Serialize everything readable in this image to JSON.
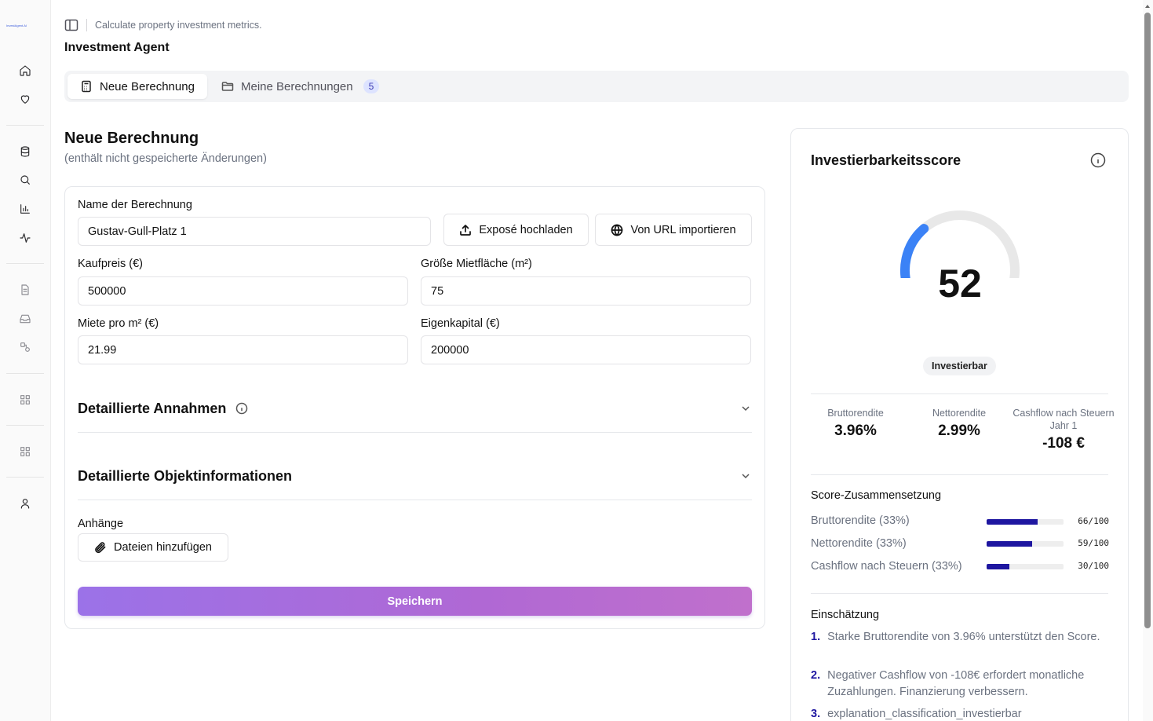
{
  "app": {
    "logo_text": "InvestAgent.AI"
  },
  "header": {
    "subtitle": "Calculate property investment metrics.",
    "title": "Investment Agent"
  },
  "tabs": [
    {
      "label": "Neue Berechnung",
      "icon": "calculator-icon",
      "active": true
    },
    {
      "label": "Meine Berechnungen",
      "icon": "folder-icon",
      "active": false,
      "badge": "5"
    }
  ],
  "form": {
    "title": "Neue Berechnung",
    "subtitle": "(enthält nicht gespeicherte Änderungen)",
    "name_label": "Name der Berechnung",
    "name_value": "Gustav-Gull-Platz 1",
    "upload_button": "Exposé hochladen",
    "url_button": "Von URL importieren",
    "kaufpreis_label": "Kaufpreis (€)",
    "kaufpreis_value": "500000",
    "flaeche_label": "Größe Mietfläche (m²)",
    "flaeche_value": "75",
    "miete_label": "Miete pro m² (€)",
    "miete_value": "21.99",
    "eigenkapital_label": "Eigenkapital (€)",
    "eigenkapital_value": "200000",
    "section_assumptions": "Detaillierte Annahmen",
    "section_object": "Detaillierte Objektinformationen",
    "attachments_label": "Anhänge",
    "attachments_button": "Dateien hinzufügen",
    "save_button": "Speichern"
  },
  "score": {
    "title": "Investierbarkeitsscore",
    "value": "52",
    "value_num": 52,
    "max": 100,
    "status": "Investierbar",
    "accent_color": "#3b82f6",
    "kpis": [
      {
        "label": "Bruttorendite",
        "value": "3.96%"
      },
      {
        "label": "Nettorendite",
        "value": "2.99%"
      },
      {
        "label": "Cashflow nach Steuern Jahr 1",
        "value": "-108 €"
      }
    ],
    "composition_title": "Score-Zusammensetzung",
    "composition": [
      {
        "label": "Bruttorendite (33%)",
        "score": 66,
        "text": "66/100"
      },
      {
        "label": "Nettorendite (33%)",
        "score": 59,
        "text": "59/100"
      },
      {
        "label": "Cashflow nach Steuern (33%)",
        "score": 30,
        "text": "30/100"
      }
    ],
    "assessment_title": "Einschätzung",
    "assessment": [
      {
        "num": "1.",
        "text": "Starke Bruttorendite von 3.96% unterstützt den Score."
      },
      {
        "num": "2.",
        "text": "Negativer Cashflow von -108€ erfordert monatliche Zuzahlungen. Finanzierung verbessern."
      },
      {
        "num": "3.",
        "text": "explanation_classification_investierbar"
      }
    ]
  },
  "sidebar": {
    "icons": [
      "home-icon",
      "heart-icon",
      "database-icon",
      "search-icon",
      "bar-chart-icon",
      "activity-icon",
      "document-icon",
      "inbox-icon",
      "shapes-icon",
      "grid-icon",
      "grid-icon",
      "user-icon"
    ]
  }
}
